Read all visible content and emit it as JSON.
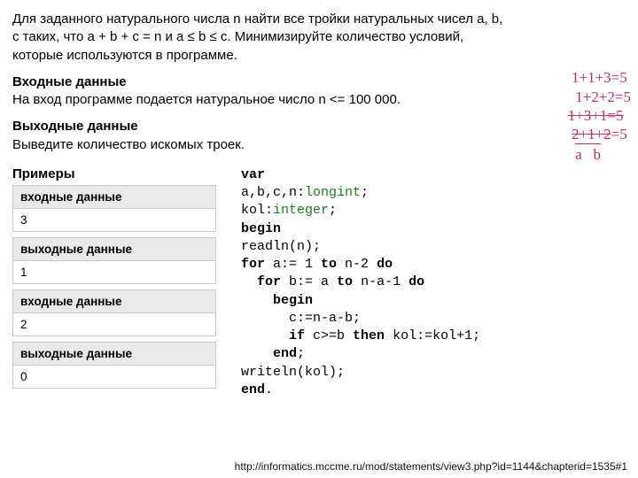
{
  "problem": {
    "p1": "Для заданного натурального числа n найти все тройки натуральных чисел a, b, c таких, что a + b + c = n и a ≤ b ≤ c. Минимизируйте количество условий, которые используются в программе.",
    "in_title": "Входные данные",
    "in_text": "На вход программе подается натуральное число n <= 100 000.",
    "out_title": "Выходные данные",
    "out_text": "Выведите количество искомых троек."
  },
  "examples": {
    "title": "Примеры",
    "hdr_in": "входные данные",
    "hdr_out": "выходные данные",
    "rows": [
      {
        "in": "3",
        "out": "1"
      },
      {
        "in": "2",
        "out": "0"
      }
    ]
  },
  "code": {
    "l1a": "var",
    "l2a": "a,b,c,n:",
    "l2b": "longint",
    "l2c": ";",
    "l3a": "kol:",
    "l3b": "integer",
    "l3c": ";",
    "l4a": "begin",
    "l5a": "readln(n);",
    "l6a": "for",
    "l6b": " a:= 1 ",
    "l6c": "to",
    "l6d": " n-2 ",
    "l6e": "do",
    "l7a": "for",
    "l7b": " b:= a ",
    "l7c": "to",
    "l7d": " n-a-1 ",
    "l7e": "do",
    "l8a": "begin",
    "l9a": "c:=n-a-b;",
    "l10a": "if",
    "l10b": " c>=b ",
    "l10c": "then",
    "l10d": " kol:=kol+1;",
    "l11a": "end",
    "l11b": ";",
    "l12a": "writeln(kol);",
    "l13a": "end",
    "l13b": "."
  },
  "annot": {
    "l1": "1+1+3=5",
    "l2": "1+2+2=5",
    "l3_strike": "1+3+1=5",
    "l4_strike": "2+1+2",
    "l4b": "=5",
    "ab": "a   b"
  },
  "footer": "http://informatics.mccme.ru/mod/statements/view3.php?id=1144&chapterid=1535#1"
}
